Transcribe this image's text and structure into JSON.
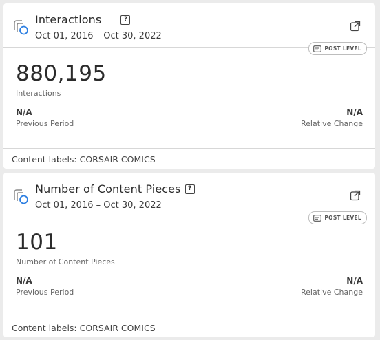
{
  "cards": [
    {
      "title": "Interactions",
      "date_range": "Oct 01, 2016 – Oct 30, 2022",
      "badge": "POST LEVEL",
      "value": "880,195",
      "value_label": "Interactions",
      "previous_value": "N/A",
      "previous_label": "Previous Period",
      "change_value": "N/A",
      "change_label": "Relative Change",
      "footer": "Content labels: CORSAIR COMICS"
    },
    {
      "title": "Number of Content Pieces",
      "date_range": "Oct 01, 2016 – Oct 30, 2022",
      "badge": "POST LEVEL",
      "value": "101",
      "value_label": "Number of Content Pieces",
      "previous_value": "N/A",
      "previous_label": "Previous Period",
      "change_value": "N/A",
      "change_label": "Relative Change",
      "footer": "Content labels: CORSAIR COMICS"
    }
  ],
  "help_glyph": "?",
  "icons": {
    "card": "layered-circle-icon",
    "help": "help-icon",
    "open": "open-external-icon",
    "badge": "post-level-icon"
  },
  "colors": {
    "accent_blue": "#2a7de1",
    "background": "#ebebeb"
  }
}
